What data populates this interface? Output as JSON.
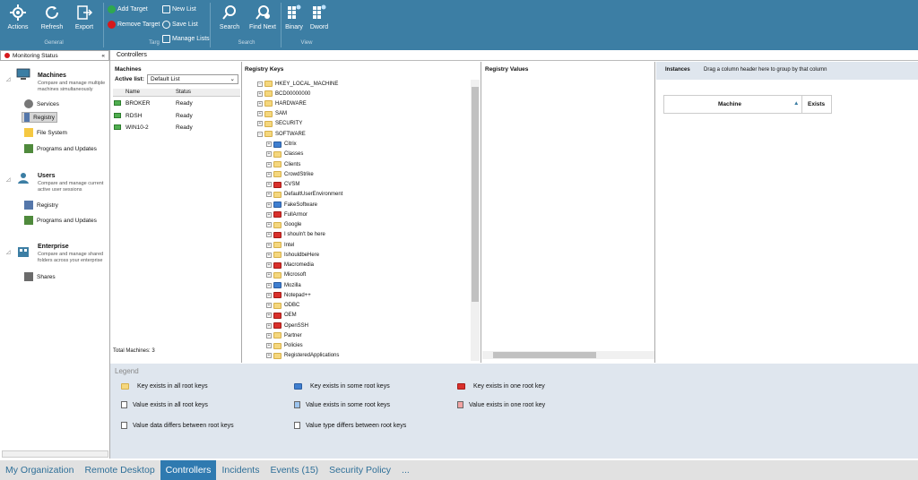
{
  "ribbon": {
    "general": {
      "actions": "Actions",
      "refresh": "Refresh",
      "export": "Export",
      "group": "General"
    },
    "targets": {
      "add": "Add Target",
      "remove": "Remove Target",
      "new_list": "New List",
      "save_list": "Save List",
      "manage_lists": "Manage Lists",
      "group": "Targ"
    },
    "search": {
      "search": "Search",
      "find_next": "Find Next",
      "group": "Search"
    },
    "view": {
      "binary": "Binary",
      "dword": "Dword",
      "group": "View"
    }
  },
  "toolbar2": {
    "title": "Controllers"
  },
  "leftnav": {
    "header": "Monitoring Status",
    "collapse": "«",
    "machines": {
      "title": "Machines",
      "desc": "Compare and manage multiple machines simultaneously",
      "items": [
        "Services",
        "Registry",
        "File System",
        "Programs and Updates"
      ]
    },
    "users": {
      "title": "Users",
      "desc": "Compare and manage current active user sessions",
      "items": [
        "Registry",
        "Programs and Updates"
      ]
    },
    "enterprise": {
      "title": "Enterprise",
      "desc": "Compare and manage shared folders across your enterprise",
      "items": [
        "Shares"
      ]
    }
  },
  "machines_panel": {
    "title": "Machines",
    "active_list_label": "Active list:",
    "active_list_value": "Default List",
    "col_name": "Name",
    "col_status": "Status",
    "rows": [
      {
        "name": "BROKER",
        "status": "Ready"
      },
      {
        "name": "RDSH",
        "status": "Ready"
      },
      {
        "name": "WIN10-2",
        "status": "Ready"
      }
    ],
    "total": "Total Machines: 3"
  },
  "registry_keys": {
    "title": "Registry Keys",
    "root": "HKEY_LOCAL_MACHINE",
    "level1": [
      "BCD00000000",
      "HARDWARE",
      "SAM",
      "SECURITY",
      "SOFTWARE"
    ],
    "software": [
      {
        "name": "Citrix",
        "color": "blue"
      },
      {
        "name": "Classes",
        "color": "yellow"
      },
      {
        "name": "Clients",
        "color": "yellow"
      },
      {
        "name": "CrowdStrike",
        "color": "yellow"
      },
      {
        "name": "CVSM",
        "color": "red"
      },
      {
        "name": "DefaultUserEnvironment",
        "color": "yellow"
      },
      {
        "name": "FakeSoftware",
        "color": "blue"
      },
      {
        "name": "FullArmor",
        "color": "red"
      },
      {
        "name": "Google",
        "color": "yellow"
      },
      {
        "name": "I shouln't be here",
        "color": "red"
      },
      {
        "name": "Intel",
        "color": "yellow"
      },
      {
        "name": "IshouldbeHere",
        "color": "yellow"
      },
      {
        "name": "Macromedia",
        "color": "red"
      },
      {
        "name": "Microsoft",
        "color": "yellow"
      },
      {
        "name": "Mozilla",
        "color": "blue"
      },
      {
        "name": "Notepad++",
        "color": "red"
      },
      {
        "name": "ODBC",
        "color": "yellow"
      },
      {
        "name": "OEM",
        "color": "red"
      },
      {
        "name": "OpenSSH",
        "color": "red"
      },
      {
        "name": "Partner",
        "color": "yellow"
      },
      {
        "name": "Policies",
        "color": "yellow"
      },
      {
        "name": "RegisteredApplications",
        "color": "yellow"
      }
    ]
  },
  "registry_values": {
    "title": "Registry Values"
  },
  "instances": {
    "title": "Instances",
    "hint": "Drag a column header here to group by that column",
    "col_machine": "Machine",
    "col_exists": "Exists"
  },
  "legend": {
    "title": "Legend",
    "items": [
      "Key exists in all root keys",
      "Key exists in some root keys",
      "Key exists in one root key",
      "Value exists in all root keys",
      "Value exists in some root keys",
      "Value exists in one root key",
      "Value data differs between root keys",
      "Value type differs between root keys"
    ]
  },
  "tabs": [
    "My Organization",
    "Remote Desktop",
    "Controllers",
    "Incidents",
    "Events (15)",
    "Security Policy",
    "..."
  ],
  "colors": {
    "ribbon": "#3c7ea4",
    "yellow": "#f5d77e",
    "blue": "#3f7fd0",
    "red": "#d9302c",
    "tab_active": "#2f7ab0"
  }
}
